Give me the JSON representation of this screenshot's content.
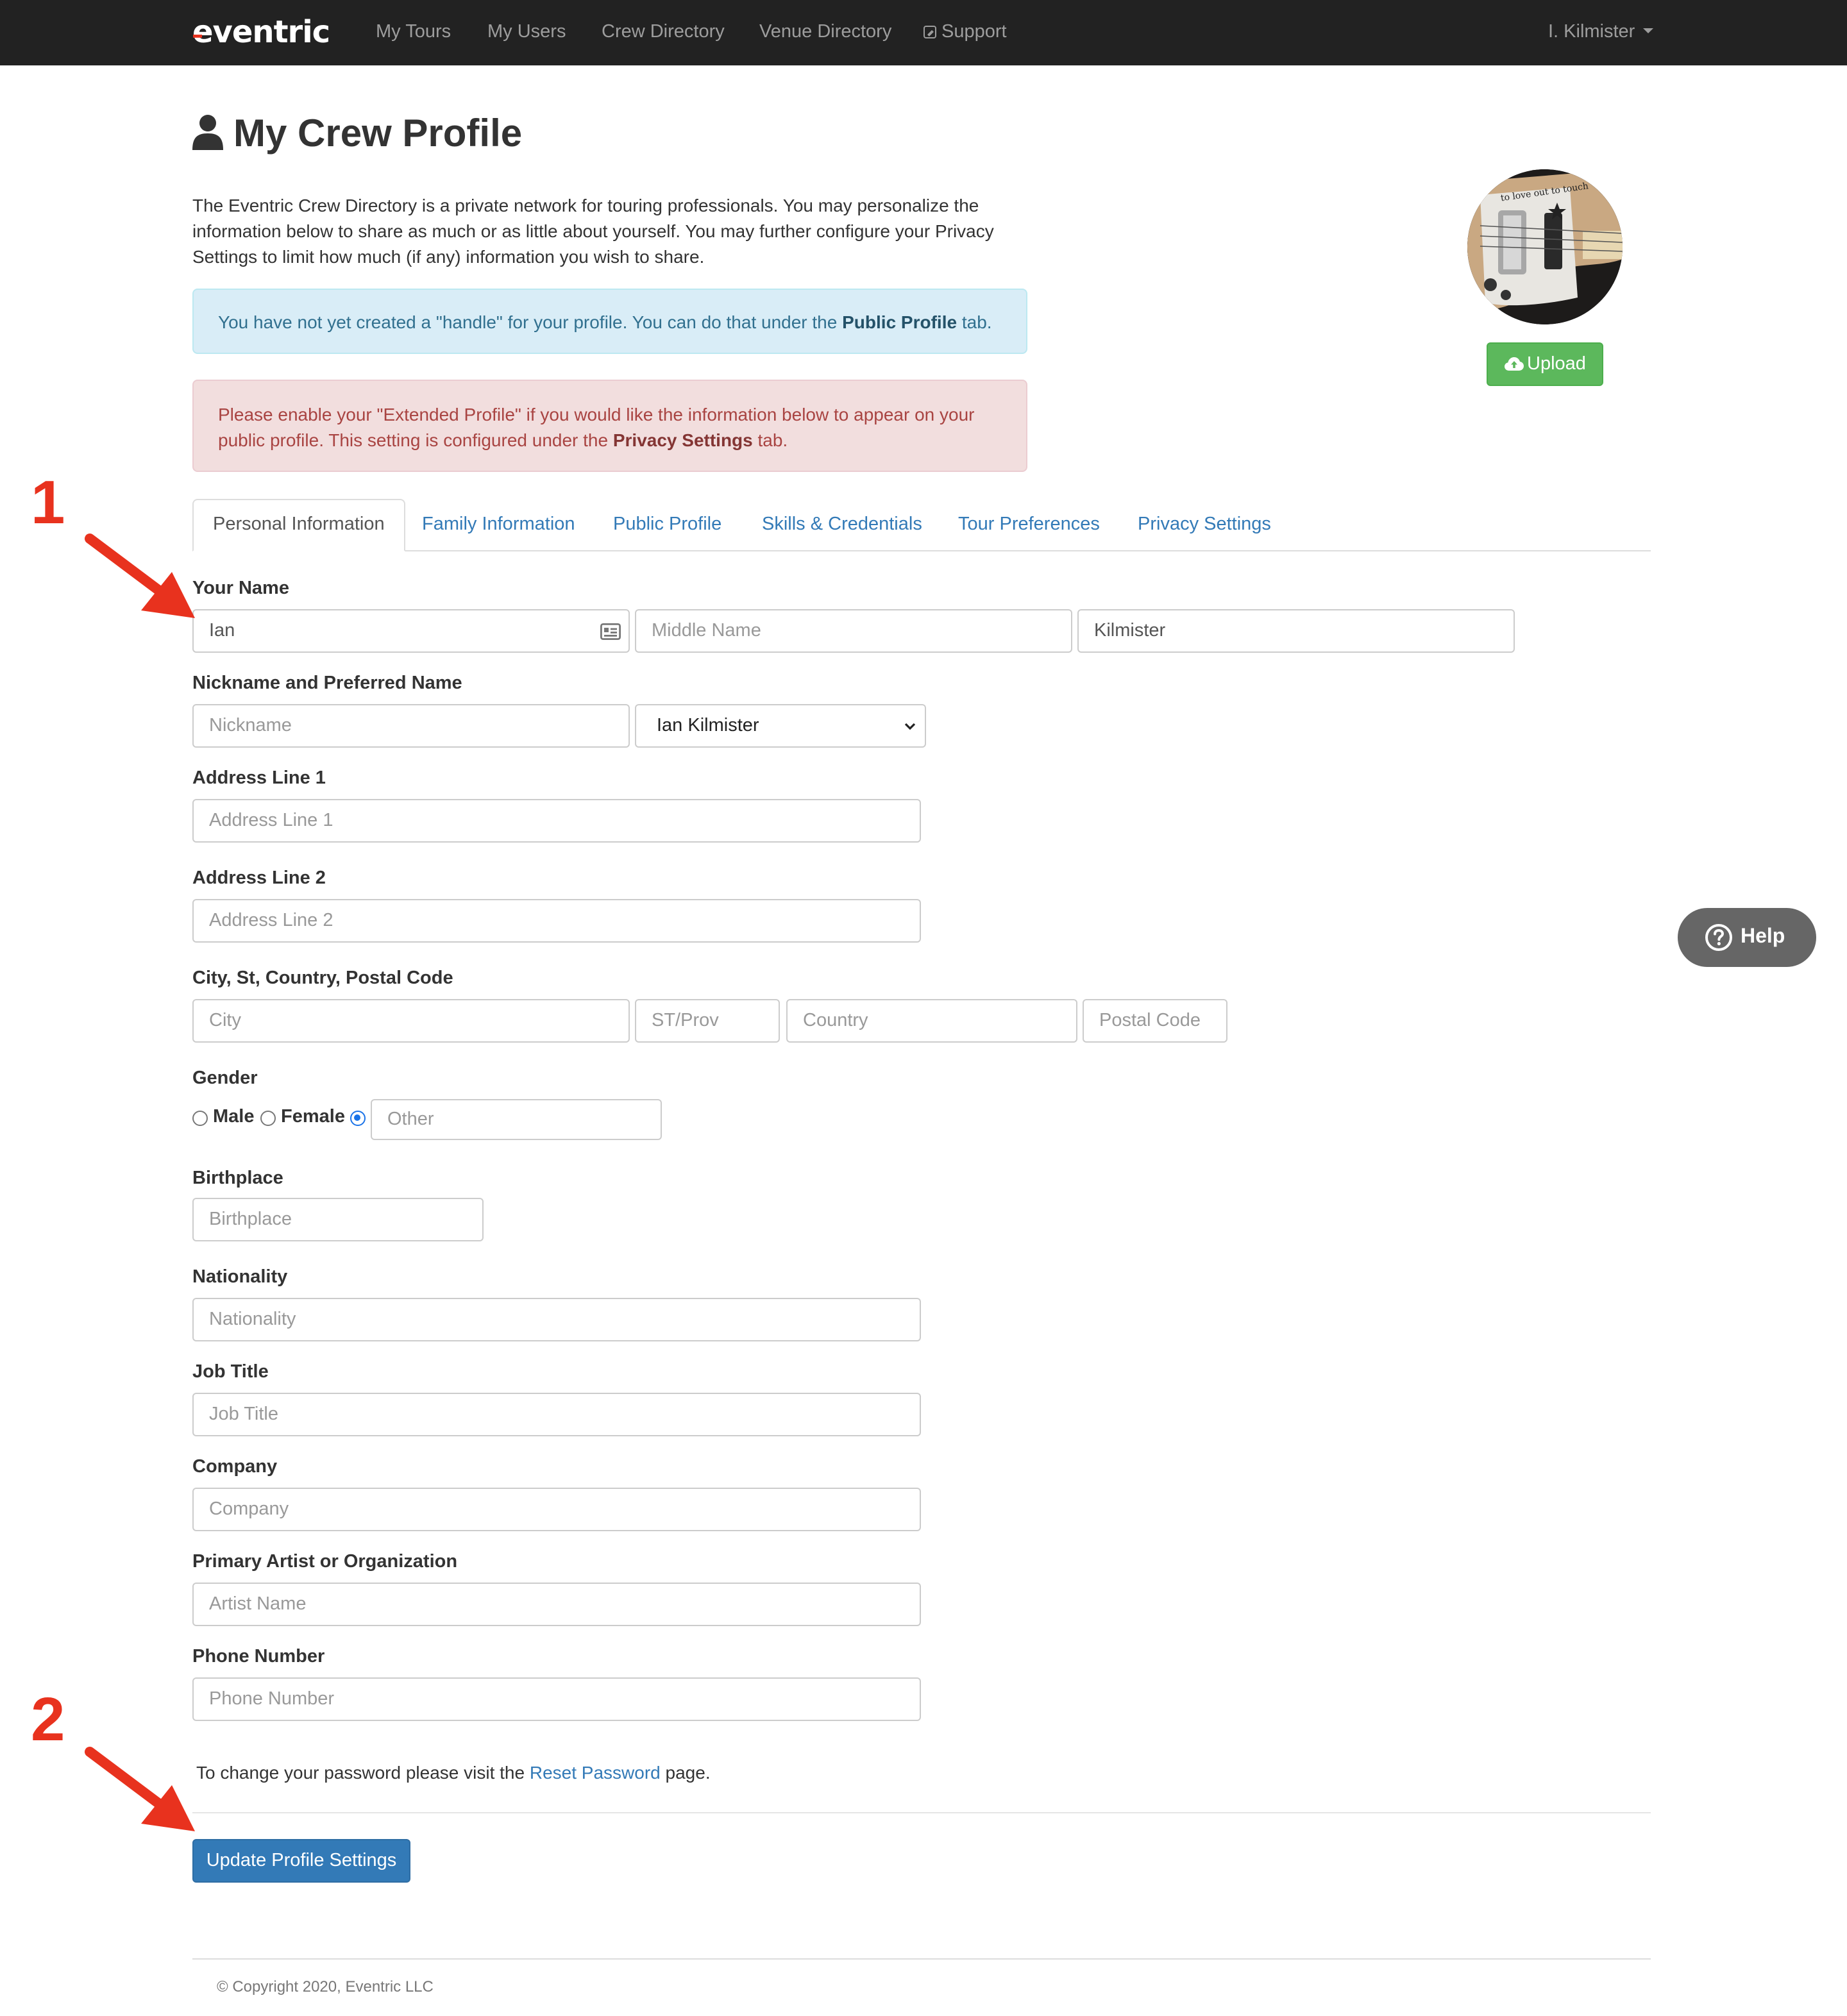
{
  "nav": {
    "brand": "eventric",
    "links": [
      "My Tours",
      "My Users",
      "Crew Directory",
      "Venue Directory",
      "Support"
    ],
    "user": "I. Kilmister"
  },
  "header": {
    "title": "My Crew Profile",
    "intro": "The Eventric Crew Directory is a private network for touring professionals. You may personalize the information below to share as much or as little about yourself. You may further configure your Privacy Settings to limit how much (if any) information you wish to share.",
    "upload_label": "Upload"
  },
  "alerts": {
    "info_before": "You have not yet created a \"handle\" for your profile. You can do that under the ",
    "info_bold": "Public Profile",
    "info_after": " tab.",
    "danger_before": "Please enable your \"Extended Profile\" if you would like the information below to appear on your public profile. This setting is configured under the ",
    "danger_bold": "Privacy Settings",
    "danger_after": " tab."
  },
  "tabs": [
    "Personal Information",
    "Family Information",
    "Public Profile",
    "Skills & Credentials",
    "Tour Preferences",
    "Privacy Settings"
  ],
  "form": {
    "name_label": "Your Name",
    "first_name": "Ian",
    "middle_placeholder": "Middle Name",
    "last_name": "Kilmister",
    "nickname_label": "Nickname and Preferred Name",
    "nickname_placeholder": "Nickname",
    "preferred_name": "Ian Kilmister",
    "address1_label": "Address Line 1",
    "address1_placeholder": "Address Line 1",
    "address2_label": "Address Line 2",
    "address2_placeholder": "Address Line 2",
    "city_label": "City, St, Country, Postal Code",
    "city_placeholder": "City",
    "state_placeholder": "ST/Prov",
    "country_placeholder": "Country",
    "postal_placeholder": "Postal Code",
    "gender_label": "Gender",
    "gender_male": "Male",
    "gender_female": "Female",
    "gender_other_placeholder": "Other",
    "birthplace_label": "Birthplace",
    "birthplace_placeholder": "Birthplace",
    "nationality_label": "Nationality",
    "nationality_placeholder": "Nationality",
    "job_label": "Job Title",
    "job_placeholder": "Job Title",
    "company_label": "Company",
    "company_placeholder": "Company",
    "artist_label": "Primary Artist or Organization",
    "artist_placeholder": "Artist Name",
    "phone_label": "Phone Number",
    "phone_placeholder": "Phone Number",
    "password_before": "To change your password please visit the ",
    "password_link": "Reset Password",
    "password_after": " page.",
    "update_label": "Update Profile Settings"
  },
  "footer": "© Copyright 2020, Eventric LLC",
  "help_label": "Help",
  "annotations": [
    "1",
    "2"
  ],
  "colors": {
    "navbar": "#222222",
    "primary": "#337ab7",
    "success": "#5cb85c",
    "annotation": "#e8321e"
  }
}
